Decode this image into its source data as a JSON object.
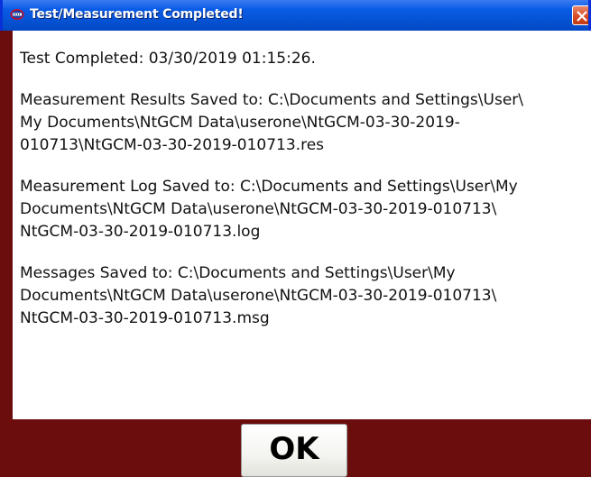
{
  "window": {
    "title": "Test/Measurement Completed!",
    "app_icon": "nist-logo-icon",
    "close_icon": "close-icon"
  },
  "messages": [
    "Test Completed: 03/30/2019 01:15:26.",
    "Measurement Results Saved to: C:\\Documents and Settings\\User\\\nMy Documents\\NtGCM Data\\userone\\NtGCM-03-30-2019-\n010713\\NtGCM-03-30-2019-010713.res",
    "Measurement Log Saved to: C:\\Documents and Settings\\User\\My\nDocuments\\NtGCM Data\\userone\\NtGCM-03-30-2019-010713\\\nNtGCM-03-30-2019-010713.log",
    "Messages Saved to: C:\\Documents and Settings\\User\\My\nDocuments\\NtGCM Data\\userone\\NtGCM-03-30-2019-010713\\\nNtGCM-03-30-2019-010713.msg"
  ],
  "buttons": {
    "ok_label": "OK"
  },
  "colors": {
    "titlebar": "#0654d8",
    "background": "#6b0d0d",
    "content": "#ffffff",
    "close": "#d9502a"
  }
}
